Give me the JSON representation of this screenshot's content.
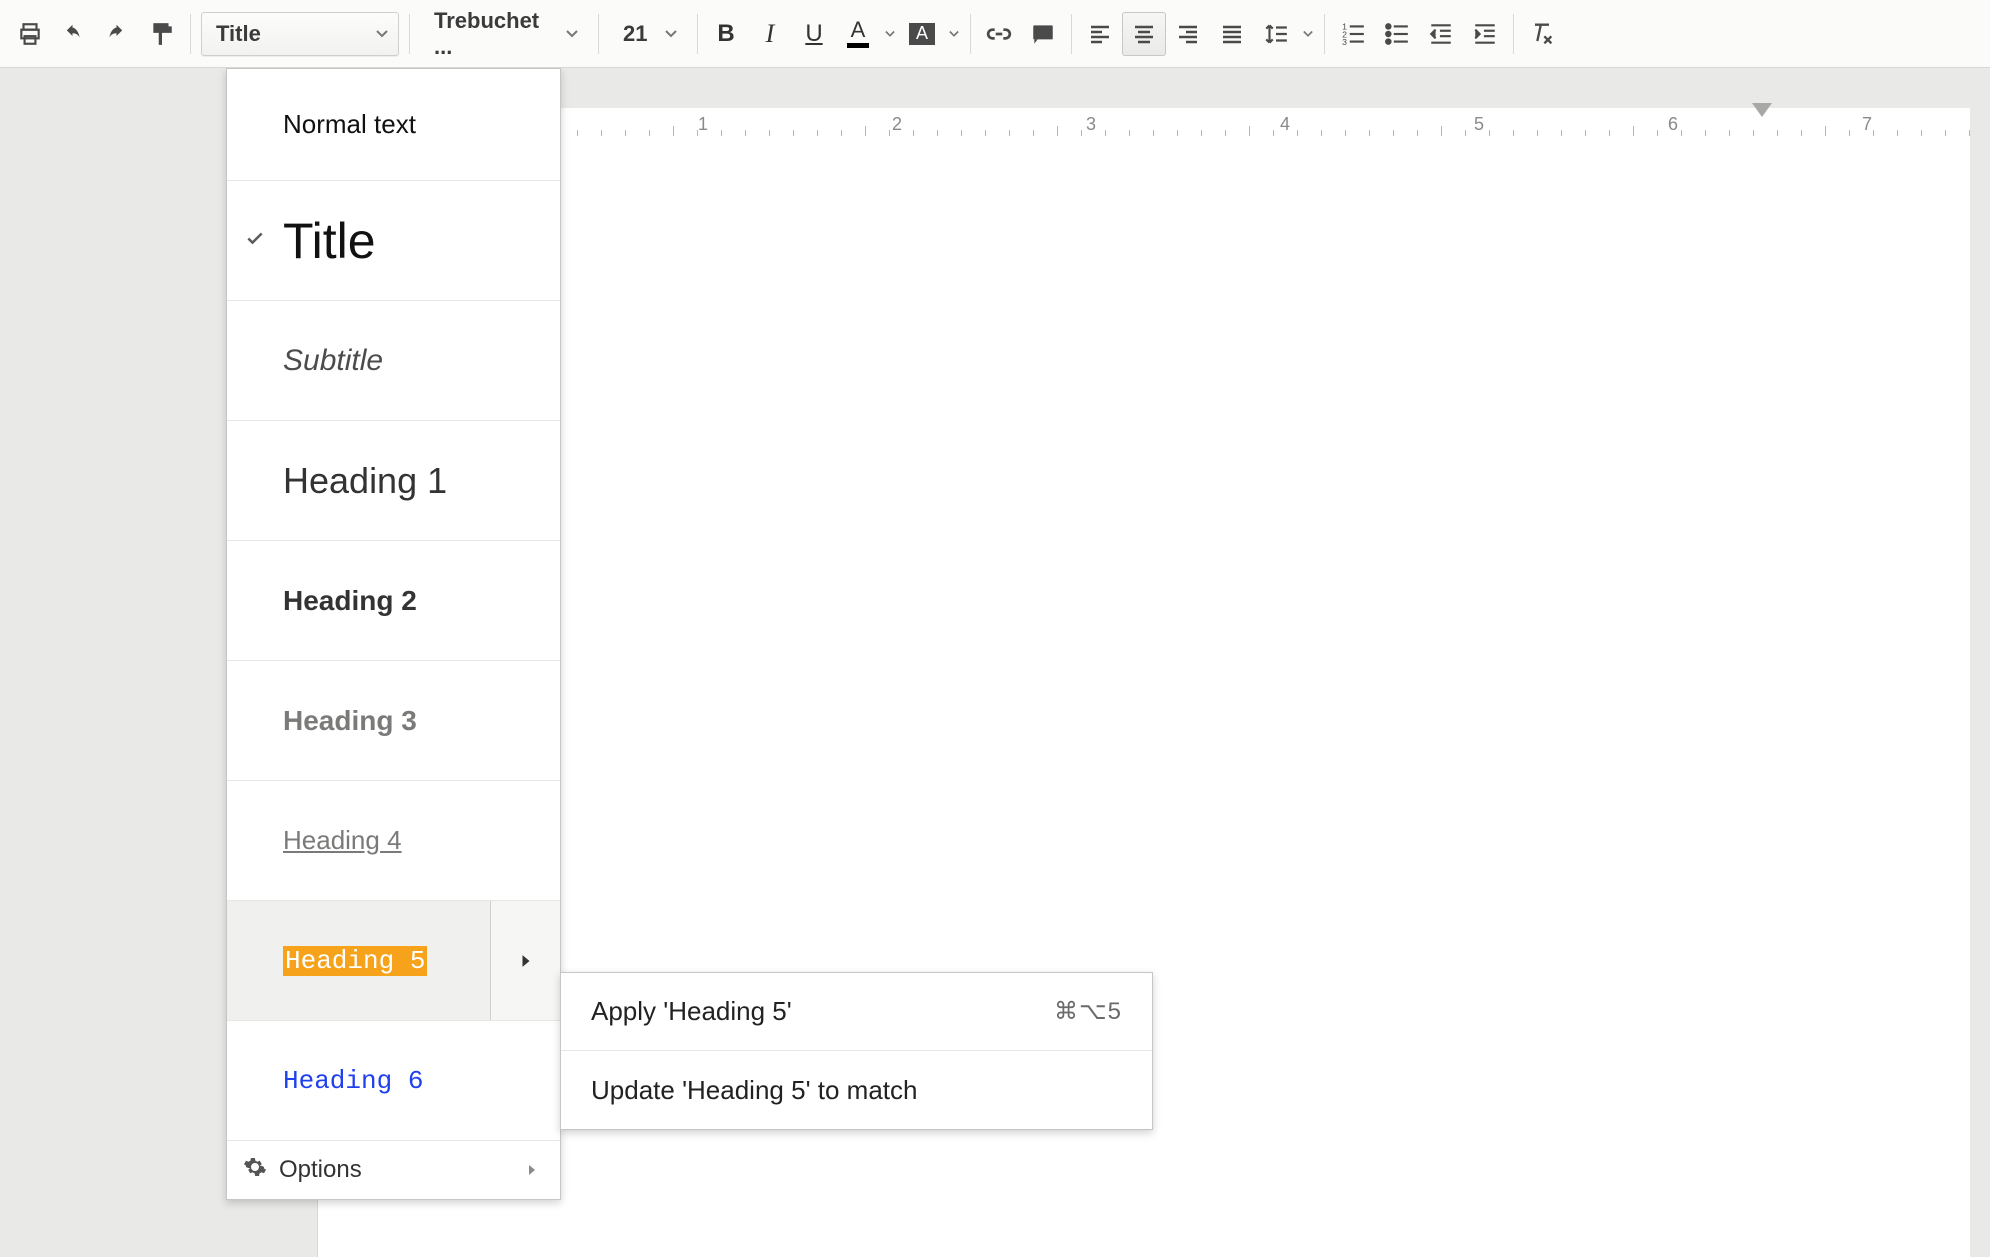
{
  "toolbar": {
    "styles_label": "Title",
    "font_label": "Trebuchet ...",
    "size_label": "21"
  },
  "ruler": {
    "numbers": [
      "1",
      "2",
      "3",
      "4",
      "5",
      "6",
      "7"
    ]
  },
  "styles_menu": {
    "items": [
      {
        "label": "Normal text"
      },
      {
        "label": "Title"
      },
      {
        "label": "Subtitle"
      },
      {
        "label": "Heading 1"
      },
      {
        "label": "Heading 2"
      },
      {
        "label": "Heading 3"
      },
      {
        "label": "Heading 4"
      },
      {
        "label": "Heading 5"
      },
      {
        "label": "Heading 6"
      }
    ],
    "options_label": "Options"
  },
  "submenu": {
    "apply_label": "Apply 'Heading 5'",
    "apply_shortcut": "⌘⌥5",
    "update_label": "Update 'Heading 5' to match"
  }
}
